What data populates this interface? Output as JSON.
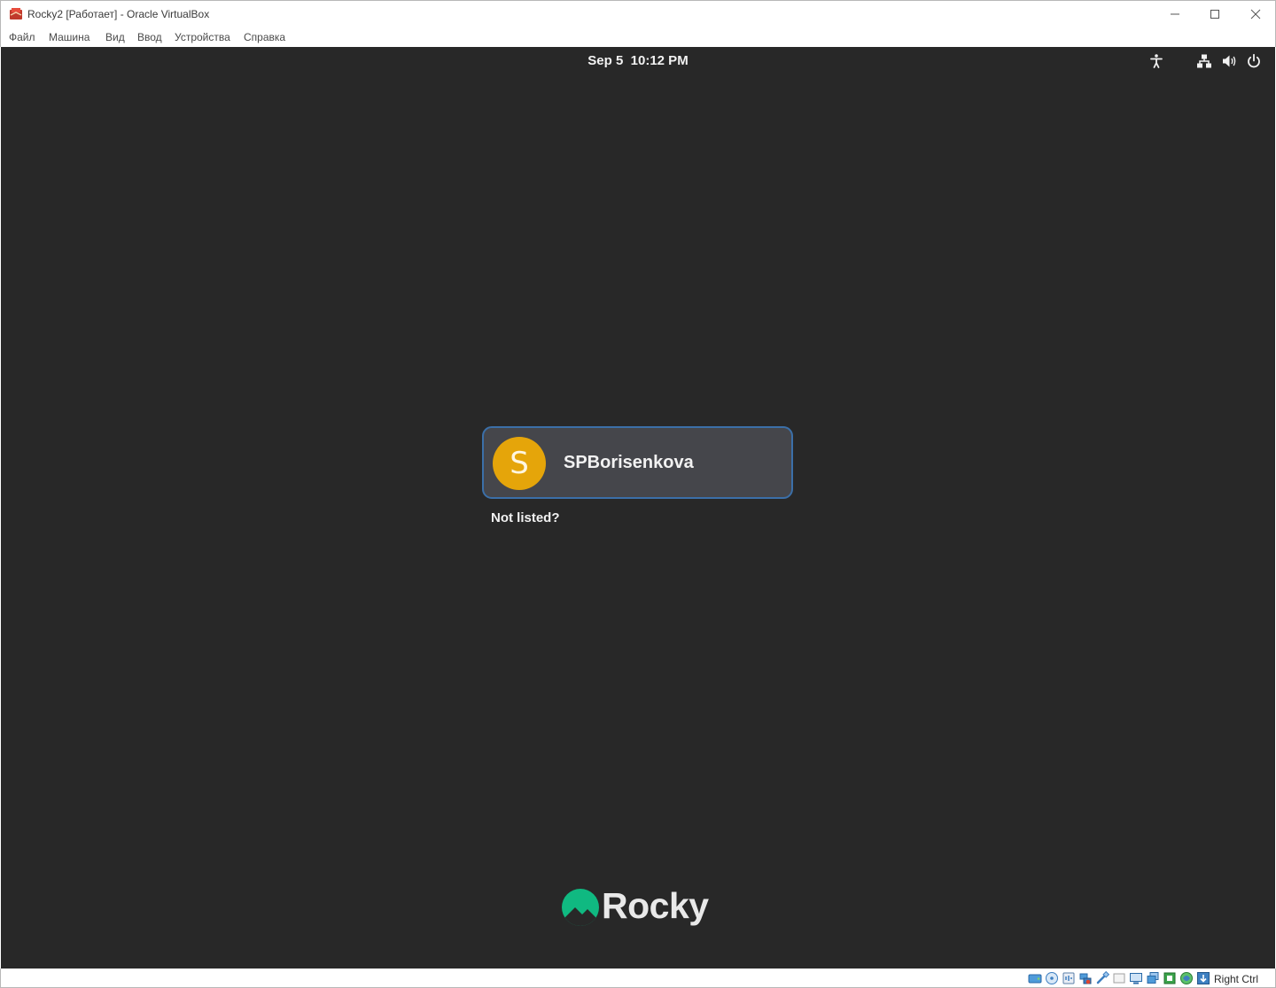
{
  "window": {
    "title": "Rocky2 [Работает] - Oracle VirtualBox",
    "controls": [
      "minimize-icon",
      "maximize-icon",
      "close-icon"
    ]
  },
  "menu": {
    "items": [
      "Файл",
      "Машина",
      "Вид",
      "Ввод",
      "Устройства",
      "Справка"
    ]
  },
  "vm": {
    "top_bar": {
      "datetime": "Sep 5  10:12 PM",
      "tray_icons": [
        "accessibility-icon",
        "network-icon",
        "volume-icon",
        "power-icon"
      ]
    },
    "login": {
      "user": {
        "avatar_initial": "S",
        "name": "SPBorisenkova",
        "avatar_color": "#e5a50a"
      },
      "not_listed": "Not listed?"
    },
    "logo": {
      "wordmark": "Rocky",
      "brand_color": "#10b981"
    }
  },
  "statusbar": {
    "host_key": "Right Ctrl",
    "icons": [
      "hard-disk-icon",
      "optical-drive-icon",
      "audio-icon",
      "network-adapter-icon",
      "usb-icon",
      "shared-folders-icon",
      "display-icon",
      "video-capture-icon",
      "recording-icon",
      "cpu-icon",
      "mouse-integration-icon",
      "keyboard-capture-icon"
    ]
  },
  "colors": {
    "vm_background": "#282828",
    "card_background": "#45464b",
    "card_border": "#3b6fa8",
    "text": "#f2f2f2"
  }
}
